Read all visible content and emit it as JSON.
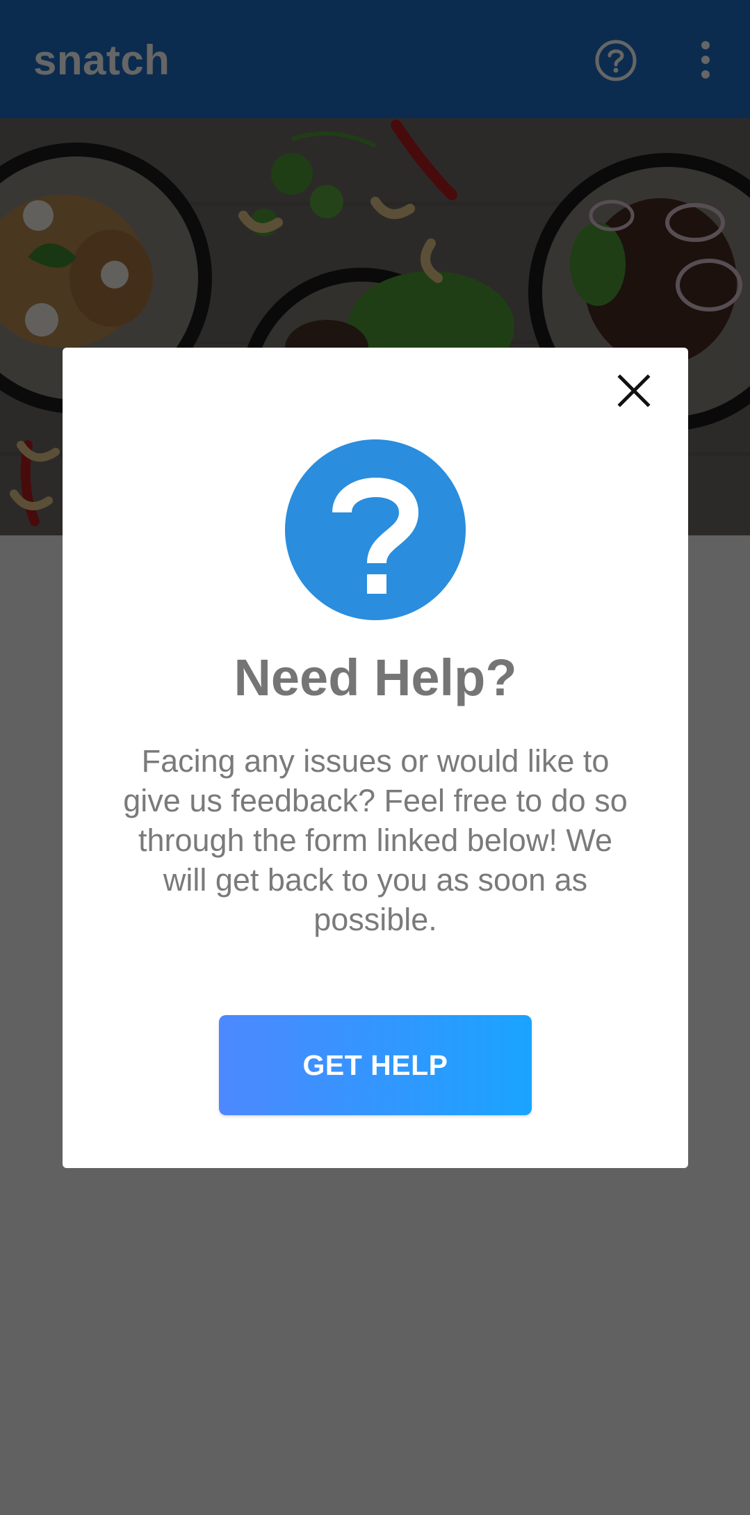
{
  "appbar": {
    "title": "snatch",
    "help_icon": "help-circle-outline-icon",
    "menu_icon": "more-vert-icon",
    "color": "#1f6fc6"
  },
  "hero": {
    "image": "food-plates-photo"
  },
  "dialog": {
    "close_icon": "close-icon",
    "help_icon": "question-circle-icon",
    "help_icon_color": "#2a8ddd",
    "title": "Need Help?",
    "body": "Facing any issues or would like to give us feedback? Feel free to do so through the form linked below! We will get back to you as soon as possible.",
    "button_label": "GET HELP",
    "button_gradient": [
      "#4d88ff",
      "#1aa3ff"
    ]
  }
}
